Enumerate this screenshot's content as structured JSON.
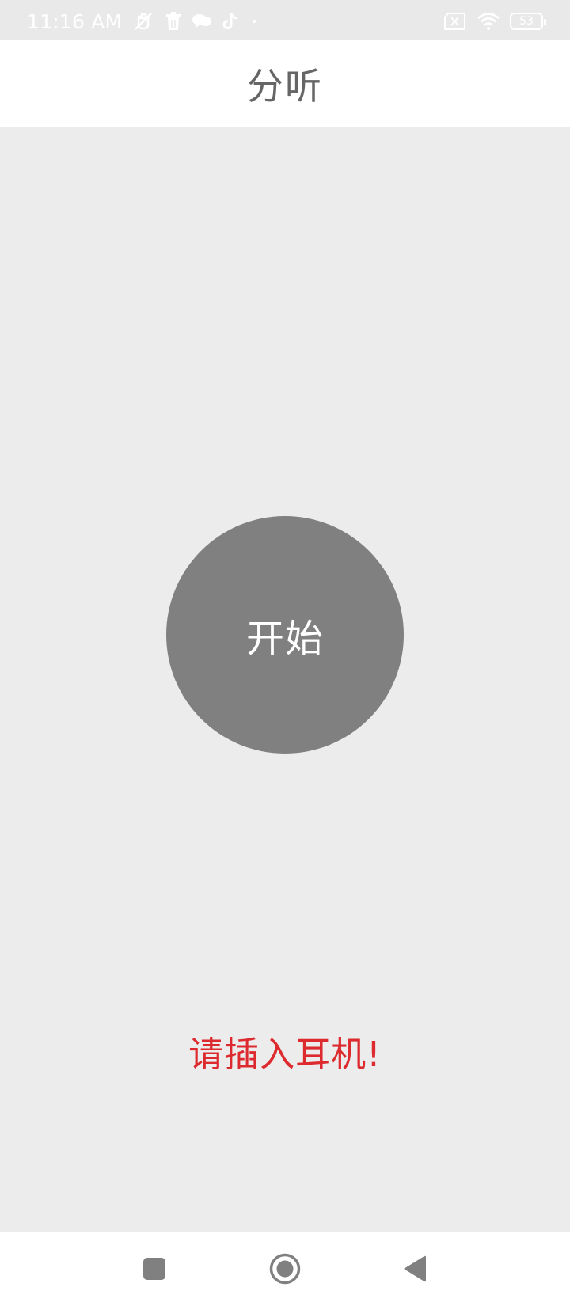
{
  "status_bar": {
    "time": "11:16 AM",
    "left_icons": [
      "mute-icon",
      "delete-icon",
      "cloud-icon",
      "tiktok-icon",
      "dot-icon"
    ],
    "right_icons": [
      "sim-off-icon",
      "wifi-icon",
      "battery-icon"
    ],
    "battery": "53"
  },
  "app_bar": {
    "title": "分听"
  },
  "main": {
    "start_label": "开始",
    "hint": "请插入耳机!",
    "colors": {
      "background": "#ececec",
      "button": "#808080",
      "hint": "#dd2a2f"
    }
  },
  "nav_bar": {
    "items": [
      "recent-apps-icon",
      "home-icon",
      "back-icon"
    ]
  }
}
